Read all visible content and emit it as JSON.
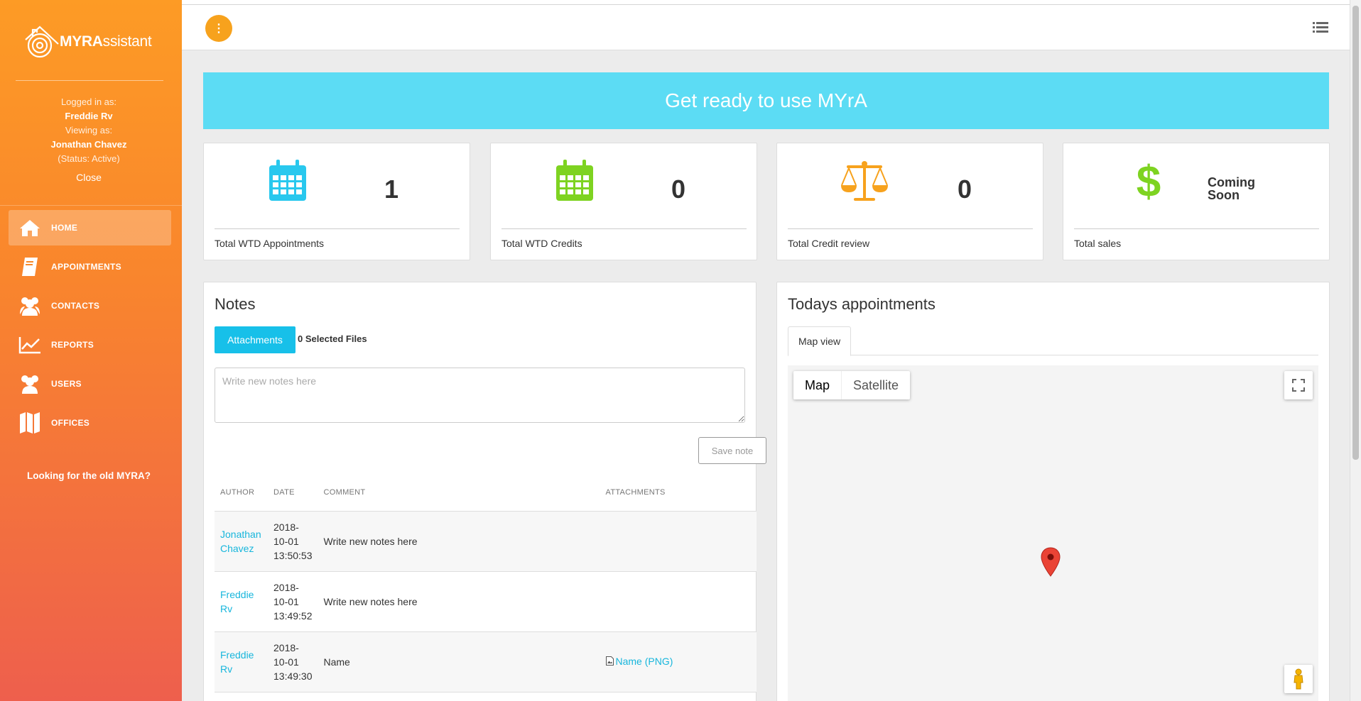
{
  "brand": {
    "name_bold": "MYRA",
    "name_light": "ssistant"
  },
  "user": {
    "logged_in_label": "Logged in as:",
    "logged_in_name": "Freddie Rv",
    "viewing_label": "Viewing as:",
    "viewing_name": "Jonathan Chavez",
    "status": "(Status: Active)",
    "close": "Close"
  },
  "nav": [
    {
      "label": "HOME",
      "icon": "home-icon",
      "active": true
    },
    {
      "label": "APPOINTMENTS",
      "icon": "book-icon"
    },
    {
      "label": "CONTACTS",
      "icon": "people-icon"
    },
    {
      "label": "REPORTS",
      "icon": "chart-line-icon"
    },
    {
      "label": "USERS",
      "icon": "people-icon"
    },
    {
      "label": "OFFICES",
      "icon": "map-icon"
    }
  ],
  "old_myra": "Looking for the old MYRA?",
  "topbar": {
    "menu_glyph": "⋮"
  },
  "banner": "Get ready to use MYrA",
  "stats": [
    {
      "value": "1",
      "label": "Total WTD Appointments",
      "icon": "calendar-icon",
      "color": "#29c8ee"
    },
    {
      "value": "0",
      "label": "Total WTD Credits",
      "icon": "calendar-icon",
      "color": "#7ed321"
    },
    {
      "value": "0",
      "label": "Total Credit review",
      "icon": "scale-icon",
      "color": "#f7a21d"
    },
    {
      "value": "Coming Soon",
      "label": "Total sales",
      "icon": "dollar-icon",
      "color": "#7ed321"
    }
  ],
  "notes": {
    "title": "Notes",
    "attachments_button": "Attachments",
    "selected_files": "0 Selected Files",
    "placeholder": "Write new notes here",
    "save_button": "Save note",
    "columns": [
      "AUTHOR",
      "DATE",
      "COMMENT",
      "ATTACHMENTS"
    ],
    "rows": [
      {
        "author_1": "Jonathan",
        "author_2": "Chavez",
        "date_1": "2018-",
        "date_2": "10-01",
        "date_3": "13:50:53",
        "comment": "Write new notes here",
        "attachment": ""
      },
      {
        "author_1": "Freddie",
        "author_2": "Rv",
        "date_1": "2018-",
        "date_2": "10-01",
        "date_3": "13:49:52",
        "comment": "Write new notes here",
        "attachment": ""
      },
      {
        "author_1": "Freddie",
        "author_2": "Rv",
        "date_1": "2018-",
        "date_2": "10-01",
        "date_3": "13:49:30",
        "comment": "Name",
        "attachment": "Name (PNG)"
      }
    ]
  },
  "appointments": {
    "title": "Todays appointments",
    "tab": "Map view",
    "map_type": [
      "Map",
      "Satellite"
    ],
    "active_map_type": "Map"
  },
  "colors": {
    "accent": "#f7a21d",
    "cyan": "#5cdcf4",
    "link": "#17b6dc"
  }
}
